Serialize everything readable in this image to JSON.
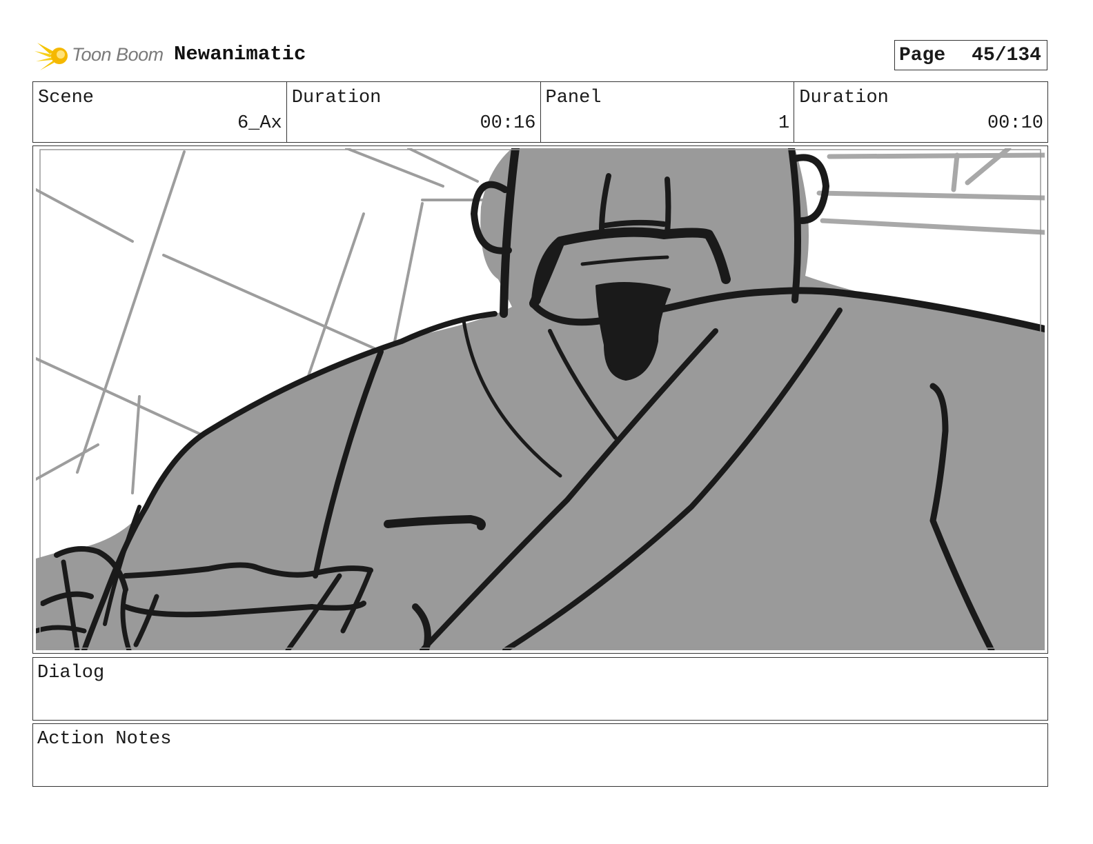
{
  "header": {
    "logo_text": "Toon Boom",
    "project_title": "Newanimatic",
    "page_label": "Page",
    "page_value": "45/134"
  },
  "info": {
    "scene_label": "Scene",
    "scene_value": "6_Ax",
    "scene_duration_label": "Duration",
    "scene_duration_value": "00:16",
    "panel_label": "Panel",
    "panel_value": "1",
    "panel_duration_label": "Duration",
    "panel_duration_value": "00:10"
  },
  "dialog": {
    "label": "Dialog",
    "text": ""
  },
  "action_notes": {
    "label": "Action Notes",
    "text": ""
  },
  "colors": {
    "sketch_fill": "#9a9a9a",
    "ink": "#1a1a1a",
    "logo_accent": "#f5c400"
  }
}
